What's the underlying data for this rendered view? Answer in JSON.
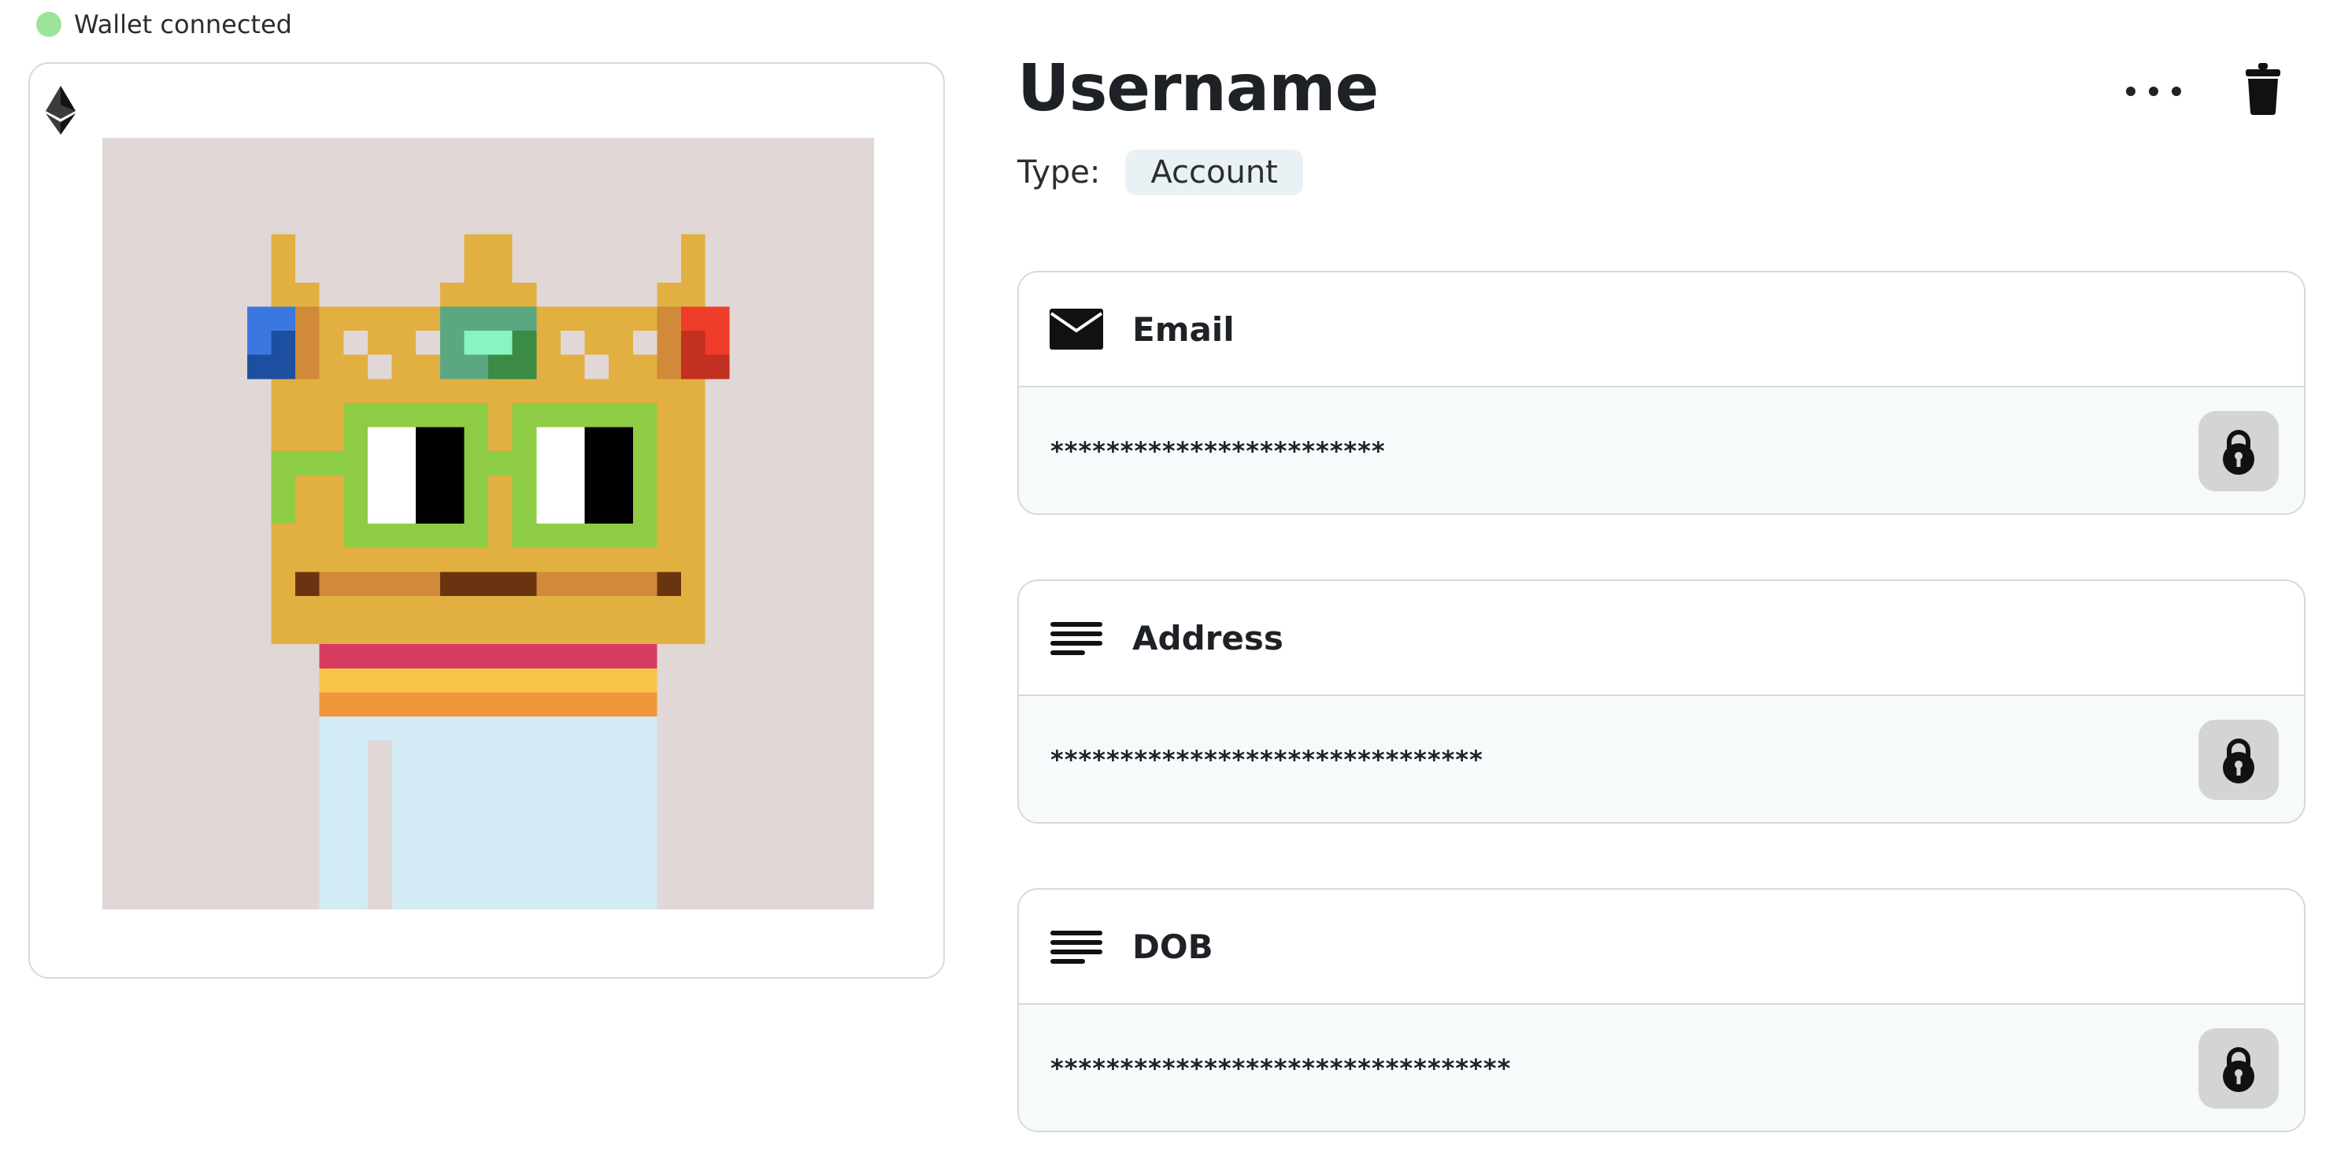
{
  "status": {
    "text": "Wallet connected",
    "color": "#9ee39a"
  },
  "profile": {
    "title": "Username",
    "type_label": "Type:",
    "type_value": "Account"
  },
  "icons": {
    "chain": "ethereum-icon",
    "more": "more-dots-icon",
    "delete": "trash-icon",
    "lock": "lock-icon",
    "email": "envelope-icon",
    "text": "text-lines-icon"
  },
  "fields": [
    {
      "label": "Email",
      "icon": "envelope-icon",
      "value": "************************"
    },
    {
      "label": "Address",
      "icon": "text-lines-icon",
      "value": "*******************************"
    },
    {
      "label": "DOB",
      "icon": "text-lines-icon",
      "value": "*********************************"
    }
  ]
}
